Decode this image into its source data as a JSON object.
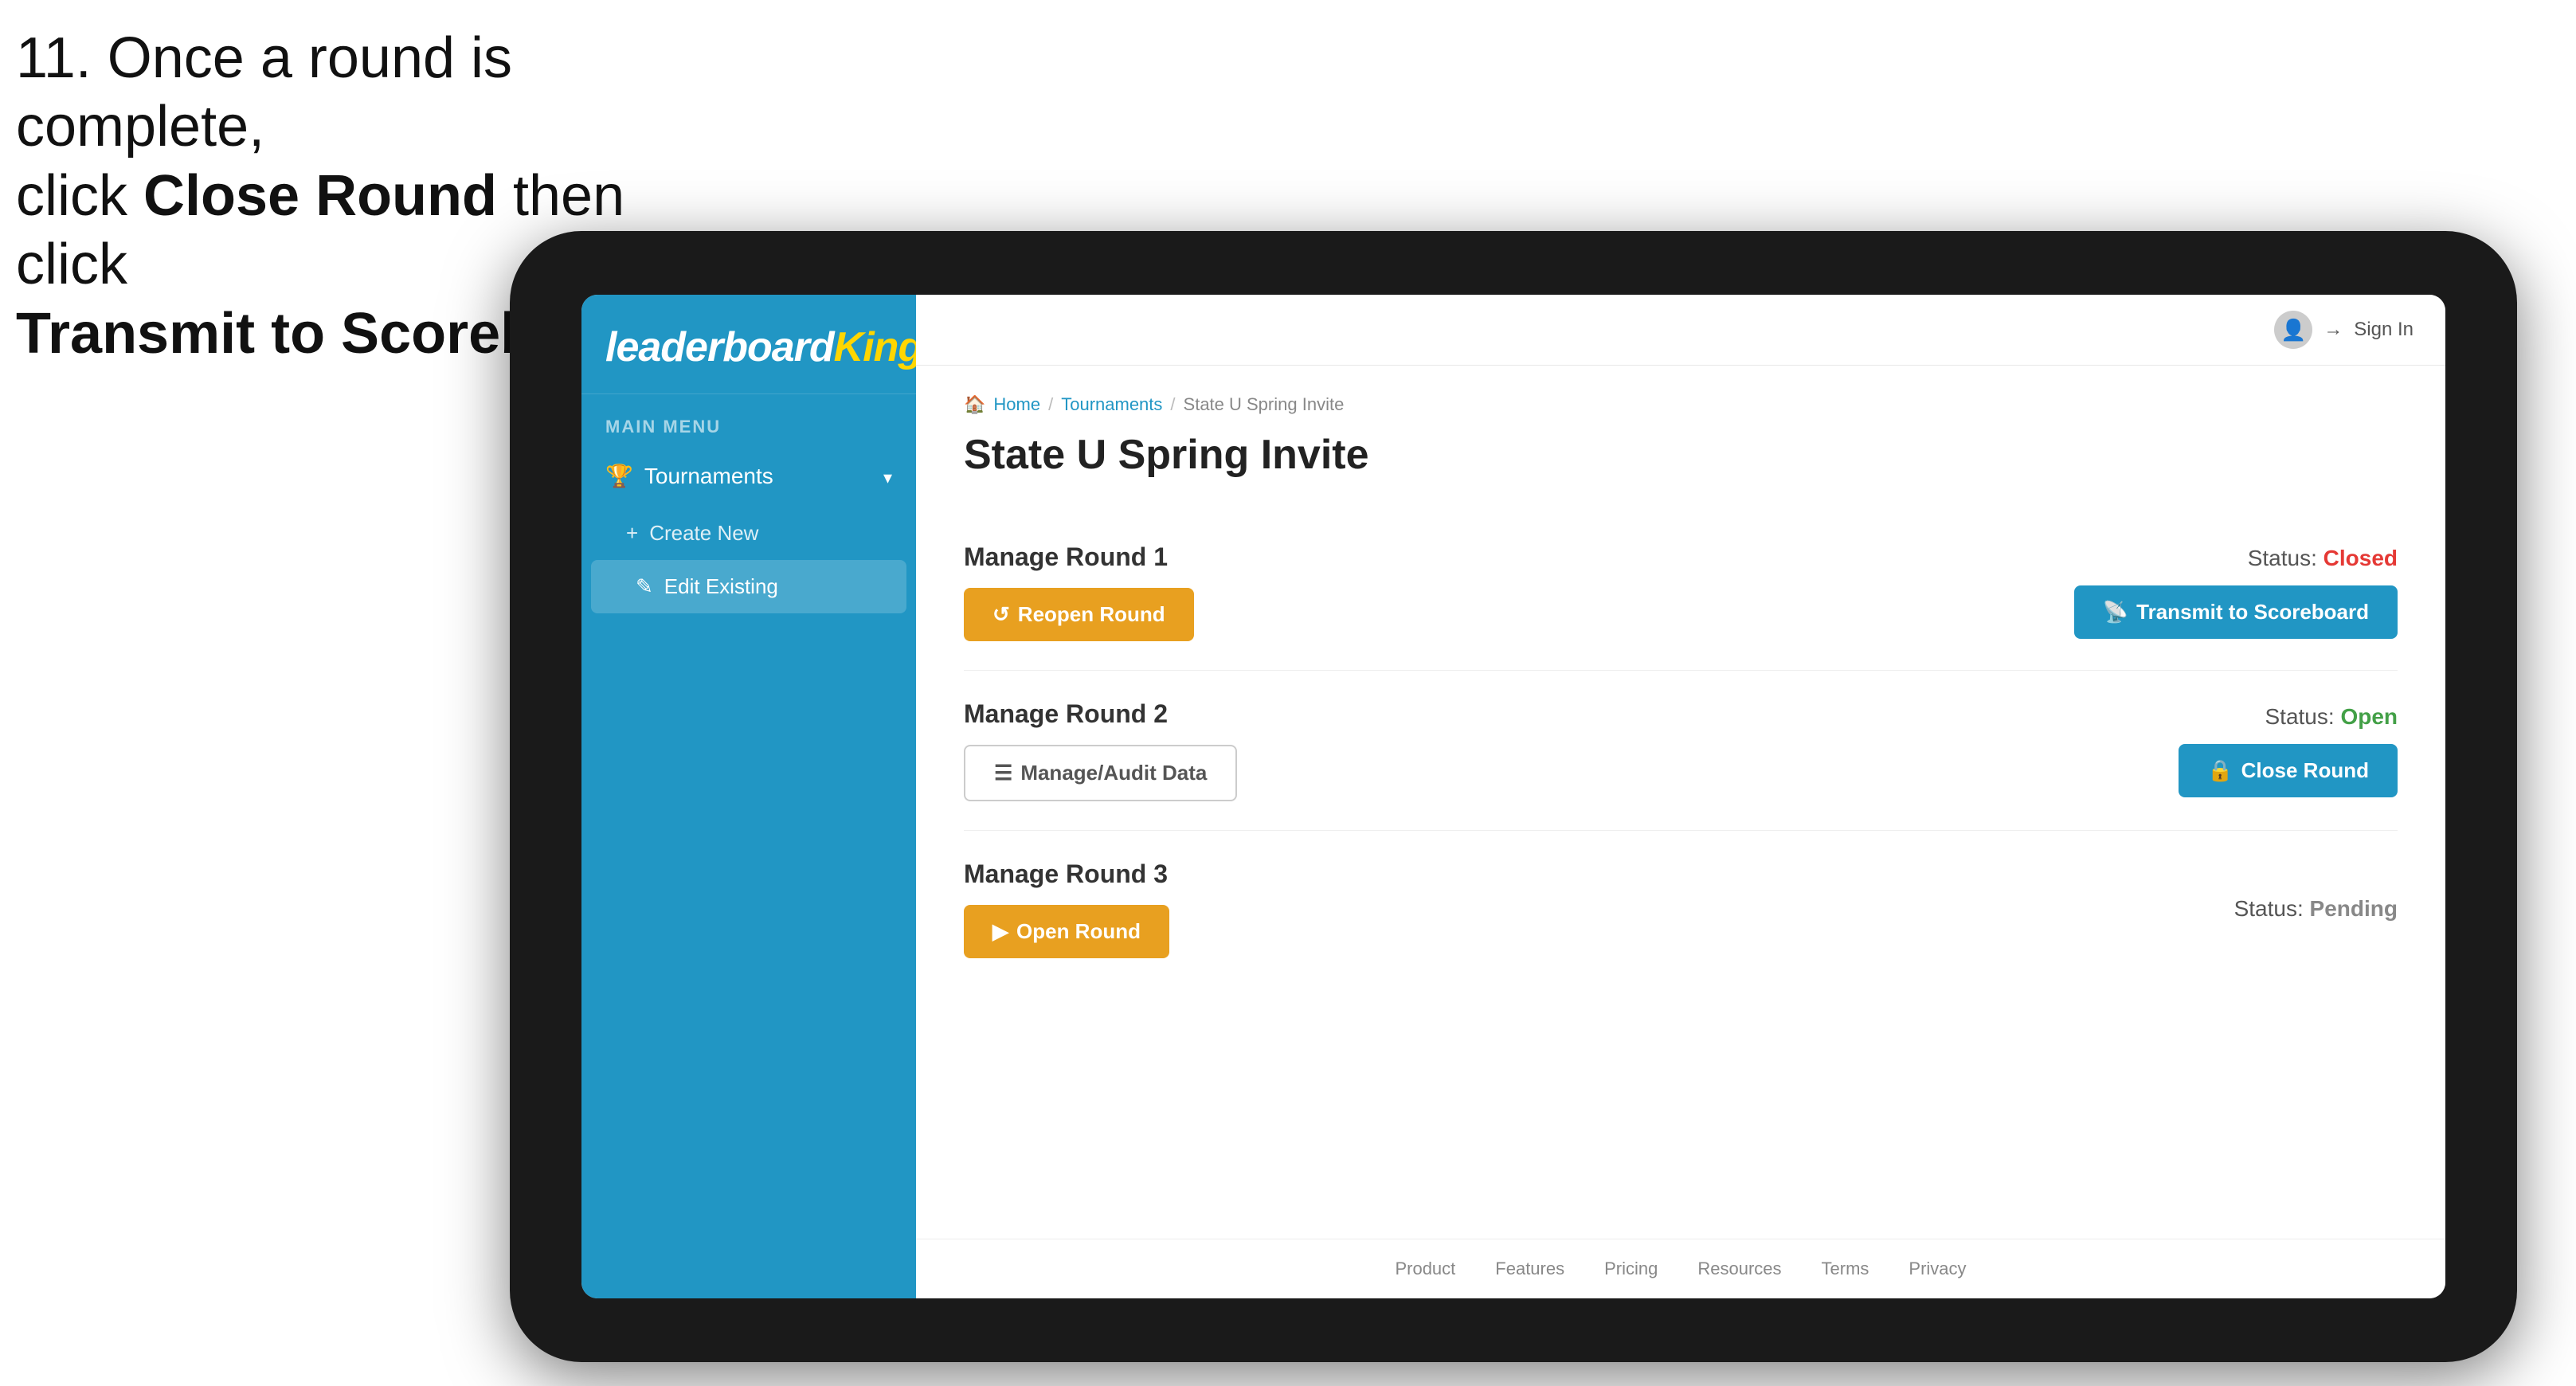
{
  "instruction": {
    "line1": "11. Once a round is complete,",
    "line2_prefix": "click ",
    "line2_bold": "Close Round",
    "line2_suffix": " then click",
    "line3_bold": "Transmit to Scoreboard."
  },
  "sidebar": {
    "logo": "leaderboard",
    "logo_king": "King",
    "menu_label": "MAIN MENU",
    "nav_items": [
      {
        "label": "Tournaments",
        "has_submenu": true
      }
    ],
    "sub_items": [
      {
        "label": "Create New",
        "icon": "+",
        "active": false
      },
      {
        "label": "Edit Existing",
        "icon": "✎",
        "active": true
      }
    ]
  },
  "topbar": {
    "sign_in": "Sign In"
  },
  "breadcrumb": {
    "home": "Home",
    "sep1": "/",
    "tournaments": "Tournaments",
    "sep2": "/",
    "current": "State U Spring Invite"
  },
  "page": {
    "title": "State U Spring Invite",
    "rounds": [
      {
        "id": "round1",
        "title": "Manage Round 1",
        "status_label": "Status:",
        "status_value": "Closed",
        "status_type": "closed",
        "buttons": [
          {
            "label": "Reopen Round",
            "style": "gold"
          },
          {
            "label": "Transmit to Scoreboard",
            "style": "blue"
          }
        ]
      },
      {
        "id": "round2",
        "title": "Manage Round 2",
        "status_label": "Status:",
        "status_value": "Open",
        "status_type": "open",
        "buttons": [
          {
            "label": "Manage/Audit Data",
            "style": "outline"
          },
          {
            "label": "Close Round",
            "style": "blue"
          }
        ]
      },
      {
        "id": "round3",
        "title": "Manage Round 3",
        "status_label": "Status:",
        "status_value": "Pending",
        "status_type": "pending",
        "buttons": [
          {
            "label": "Open Round",
            "style": "gold"
          }
        ]
      }
    ]
  },
  "footer": {
    "links": [
      "Product",
      "Features",
      "Pricing",
      "Resources",
      "Terms",
      "Privacy"
    ]
  }
}
